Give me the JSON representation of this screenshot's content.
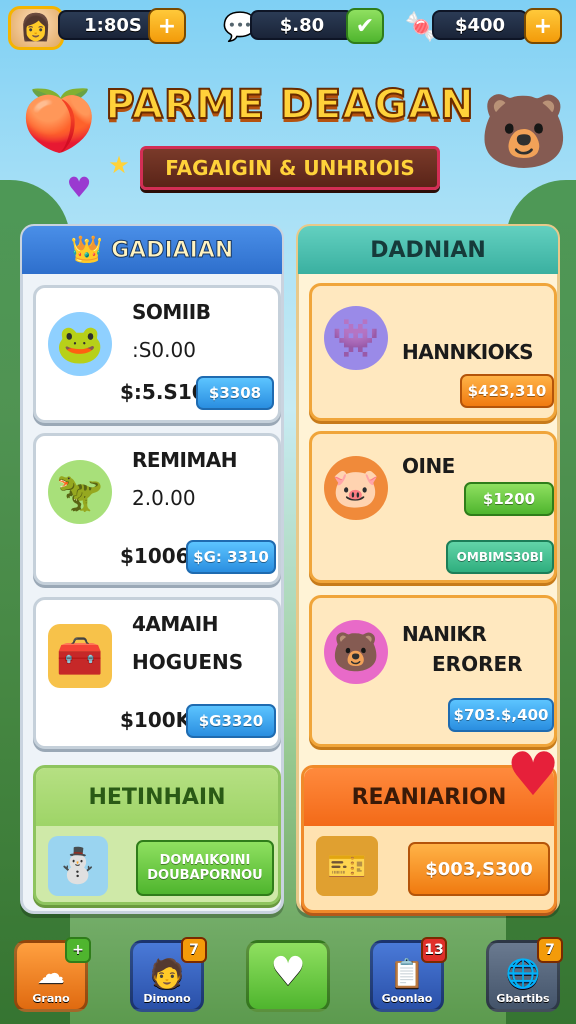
{
  "top_bar": {
    "coins": "1:80S",
    "currency_two": "$.80",
    "currency_three": "$400"
  },
  "title": "PARME DEAGAN",
  "subtitle": "FAGAIGIN & UNHRIOIS",
  "left_panel": {
    "header": "GADIAIAN",
    "cards": [
      {
        "name": "SOMIIB",
        "sub": ":S0.00",
        "price": "$:5.S10",
        "button": "$3308"
      },
      {
        "name": "REMIMAH",
        "sub": "2.0.00",
        "price": "$1006",
        "button": "$G: 3310"
      },
      {
        "name": "4AMAIH",
        "sub": "HOGUENS",
        "price": "$100K",
        "button": "$G3320"
      }
    ],
    "bottom": {
      "header": "HETINHAIN",
      "button_line1": "DOMAIKOINI",
      "button_line2": "DOUBAPORNOU"
    }
  },
  "right_panel": {
    "header": "DADNIAN",
    "cards": [
      {
        "name": "HANNKIOKS",
        "button": "$423,310"
      },
      {
        "name": "OINE",
        "button_top": "$1200",
        "button_bottom": "OMBIMS30BI"
      },
      {
        "name": "NANIKR",
        "sub": "ERORER",
        "button": "$703.$,400"
      }
    ],
    "bottom": {
      "header": "REANIARION",
      "button": "$003,S300"
    }
  },
  "bottom_nav": [
    {
      "label": "Grano",
      "badge": "+"
    },
    {
      "label": "Dimono",
      "badge": "7"
    },
    {
      "label": "",
      "badge": ""
    },
    {
      "label": "Goonlao",
      "badge": "13"
    },
    {
      "label": "Gbartibs",
      "badge": "7"
    }
  ],
  "colors": {
    "left_header": "#2e6fcc",
    "right_header": "#3ab0a0",
    "title_fill": "#ffd23a",
    "accent_orange": "#f07a10",
    "accent_green": "#4fb52e"
  }
}
